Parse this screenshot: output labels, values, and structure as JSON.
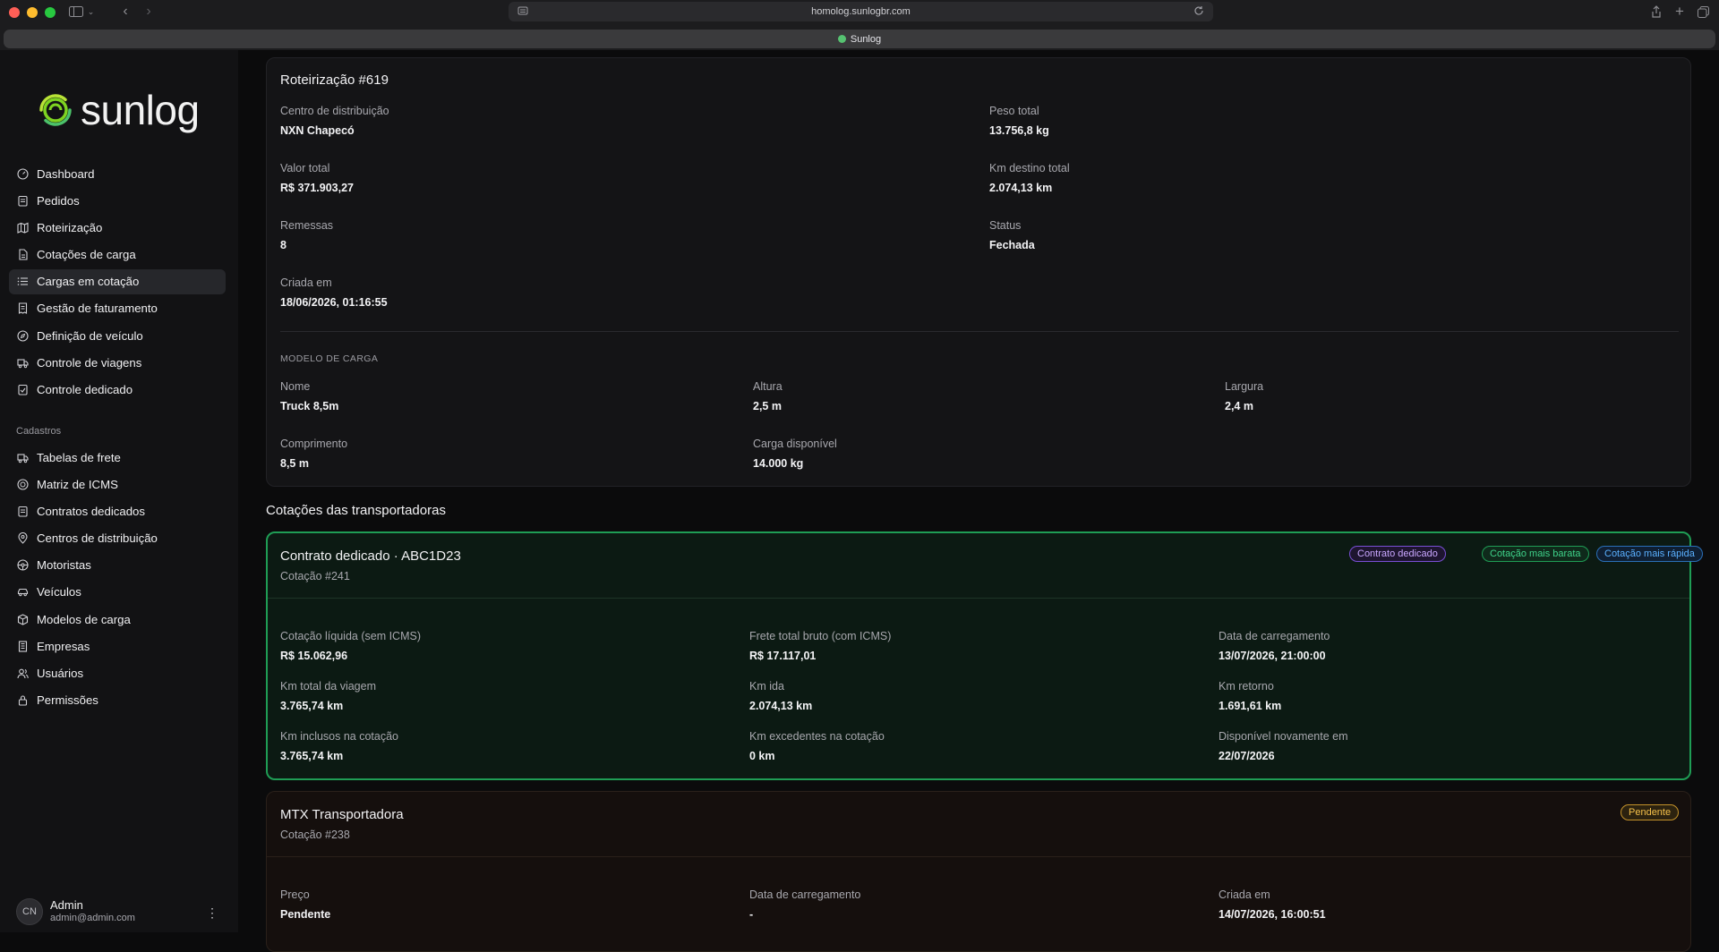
{
  "browser": {
    "url": "homolog.sunlogbr.com",
    "tab_title": "Sunlog"
  },
  "sidebar": {
    "brand": "sunlog",
    "items": [
      {
        "label": "Dashboard",
        "icon": "dashboard-icon"
      },
      {
        "label": "Pedidos",
        "icon": "clipboard-icon"
      },
      {
        "label": "Roteirização",
        "icon": "map-icon"
      },
      {
        "label": "Cotações de carga",
        "icon": "document-icon"
      },
      {
        "label": "Cargas em cotação",
        "icon": "list-icon",
        "active": true
      },
      {
        "label": "Gestão de faturamento",
        "icon": "receipt-icon"
      },
      {
        "label": "Definição de veículo",
        "icon": "compass-icon"
      },
      {
        "label": "Controle de viagens",
        "icon": "truck-icon"
      },
      {
        "label": "Controle dedicado",
        "icon": "clipboard-check-icon"
      }
    ],
    "section_label": "Cadastros",
    "items2": [
      {
        "label": "Tabelas de frete",
        "icon": "truck-icon"
      },
      {
        "label": "Matriz de ICMS",
        "icon": "target-icon"
      },
      {
        "label": "Contratos dedicados",
        "icon": "clipboard-icon"
      },
      {
        "label": "Centros de distribuição",
        "icon": "pin-icon"
      },
      {
        "label": "Motoristas",
        "icon": "steering-wheel-icon"
      },
      {
        "label": "Veículos",
        "icon": "car-icon"
      },
      {
        "label": "Modelos de carga",
        "icon": "box-icon"
      },
      {
        "label": "Empresas",
        "icon": "building-icon"
      },
      {
        "label": "Usuários",
        "icon": "users-icon"
      },
      {
        "label": "Permissões",
        "icon": "lock-icon"
      }
    ],
    "user": {
      "initials": "CN",
      "name": "Admin",
      "email": "admin@admin.com"
    }
  },
  "routing": {
    "title": "Roteirização #619",
    "fields_left": [
      {
        "label": "Centro de distribuição",
        "value": "NXN Chapecó"
      },
      {
        "label": "Valor total",
        "value": "R$ 371.903,27"
      },
      {
        "label": "Remessas",
        "value": "8"
      },
      {
        "label": "Criada em",
        "value": "18/06/2026, 01:16:55"
      }
    ],
    "fields_right": [
      {
        "label": "Peso total",
        "value": "13.756,8 kg"
      },
      {
        "label": "Km destino total",
        "value": "2.074,13 km"
      },
      {
        "label": "Status",
        "value": "Fechada"
      }
    ],
    "load_model_caption": "MODELO DE CARGA",
    "load_model": [
      {
        "label": "Nome",
        "value": "Truck 8,5m"
      },
      {
        "label": "Altura",
        "value": "2,5 m"
      },
      {
        "label": "Largura",
        "value": "2,4 m"
      },
      {
        "label": "Comprimento",
        "value": "8,5 m"
      },
      {
        "label": "Carga disponível",
        "value": "14.000 kg"
      }
    ]
  },
  "quotes_heading": "Cotações das transportadoras",
  "quote1": {
    "title": "Contrato dedicado · ABC1D23",
    "subtitle": "Cotação #241",
    "badges": [
      {
        "label": "Contrato dedicado",
        "color": "#c9a7ff"
      },
      {
        "label": "Cotação mais barata",
        "color": "#3fd28a"
      },
      {
        "label": "Cotação mais rápida",
        "color": "#5ab0ff"
      }
    ],
    "fields": [
      {
        "label": "Cotação líquida (sem ICMS)",
        "value": "R$ 15.062,96"
      },
      {
        "label": "Frete total bruto (com ICMS)",
        "value": "R$ 17.117,01"
      },
      {
        "label": "Data de carregamento",
        "value": "13/07/2026, 21:00:00"
      },
      {
        "label": "Km total da viagem",
        "value": "3.765,74 km"
      },
      {
        "label": "Km ida",
        "value": "2.074,13 km"
      },
      {
        "label": "Km retorno",
        "value": "1.691,61 km"
      },
      {
        "label": "Km inclusos na cotação",
        "value": "3.765,74 km"
      },
      {
        "label": "Km excedentes na cotação",
        "value": "0 km"
      },
      {
        "label": "Disponível novamente em",
        "value": "22/07/2026"
      }
    ]
  },
  "quote2": {
    "title": "MTX Transportadora",
    "subtitle": "Cotação #238",
    "badge": {
      "label": "Pendente",
      "color": "#f5c04a"
    },
    "fields": [
      {
        "label": "Preço",
        "value": "Pendente"
      },
      {
        "label": "Data de carregamento",
        "value": "-"
      },
      {
        "label": "Criada em",
        "value": "14/07/2026, 16:00:51"
      }
    ]
  }
}
